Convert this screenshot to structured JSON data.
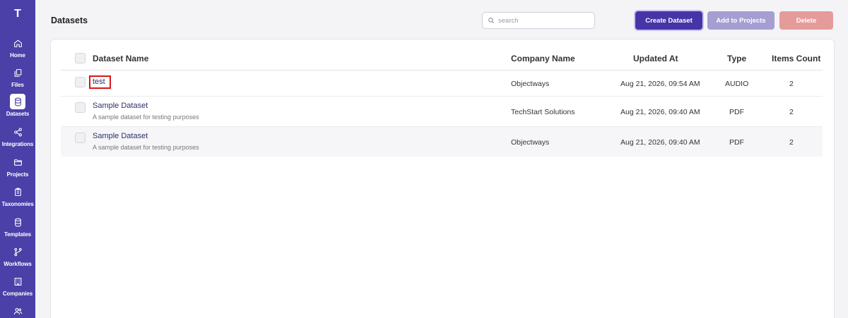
{
  "sidebar": {
    "logo": "T",
    "items": [
      {
        "label": "Home",
        "icon": "home-icon",
        "active": false
      },
      {
        "label": "Files",
        "icon": "files-icon",
        "active": false
      },
      {
        "label": "Datasets",
        "icon": "database-icon",
        "active": true
      },
      {
        "label": "Integrations",
        "icon": "share-icon",
        "active": false
      },
      {
        "label": "Projects",
        "icon": "folder-icon",
        "active": false
      },
      {
        "label": "Taxonomies",
        "icon": "clipboard-icon",
        "active": false
      },
      {
        "label": "Templates",
        "icon": "stack-icon",
        "active": false
      },
      {
        "label": "Workflows",
        "icon": "branch-icon",
        "active": false
      },
      {
        "label": "Companies",
        "icon": "building-icon",
        "active": false
      },
      {
        "label": "",
        "icon": "users-icon",
        "active": false
      }
    ]
  },
  "header": {
    "title": "Datasets",
    "search_placeholder": "search",
    "create_label": "Create Dataset",
    "add_label": "Add to Projects",
    "delete_label": "Delete"
  },
  "table": {
    "columns": [
      "Dataset Name",
      "Company Name",
      "Updated At",
      "Type",
      "Items Count"
    ],
    "rows": [
      {
        "name": "test",
        "description": "",
        "company": "Objectways",
        "updated": "Aug 21, 2026, 09:54 AM",
        "type": "AUDIO",
        "count": "2"
      },
      {
        "name": "Sample Dataset",
        "description": "A sample dataset for testing purposes",
        "company": "TechStart Solutions",
        "updated": "Aug 21, 2026, 09:40 AM",
        "type": "PDF",
        "count": "2"
      },
      {
        "name": "Sample Dataset",
        "description": "A sample dataset for testing purposes",
        "company": "Objectways",
        "updated": "Aug 21, 2026, 09:40 AM",
        "type": "PDF",
        "count": "2"
      }
    ]
  },
  "colors": {
    "sidebar": "#4b3fa8",
    "primary": "#4635a6",
    "highlight": "#d9161b"
  }
}
